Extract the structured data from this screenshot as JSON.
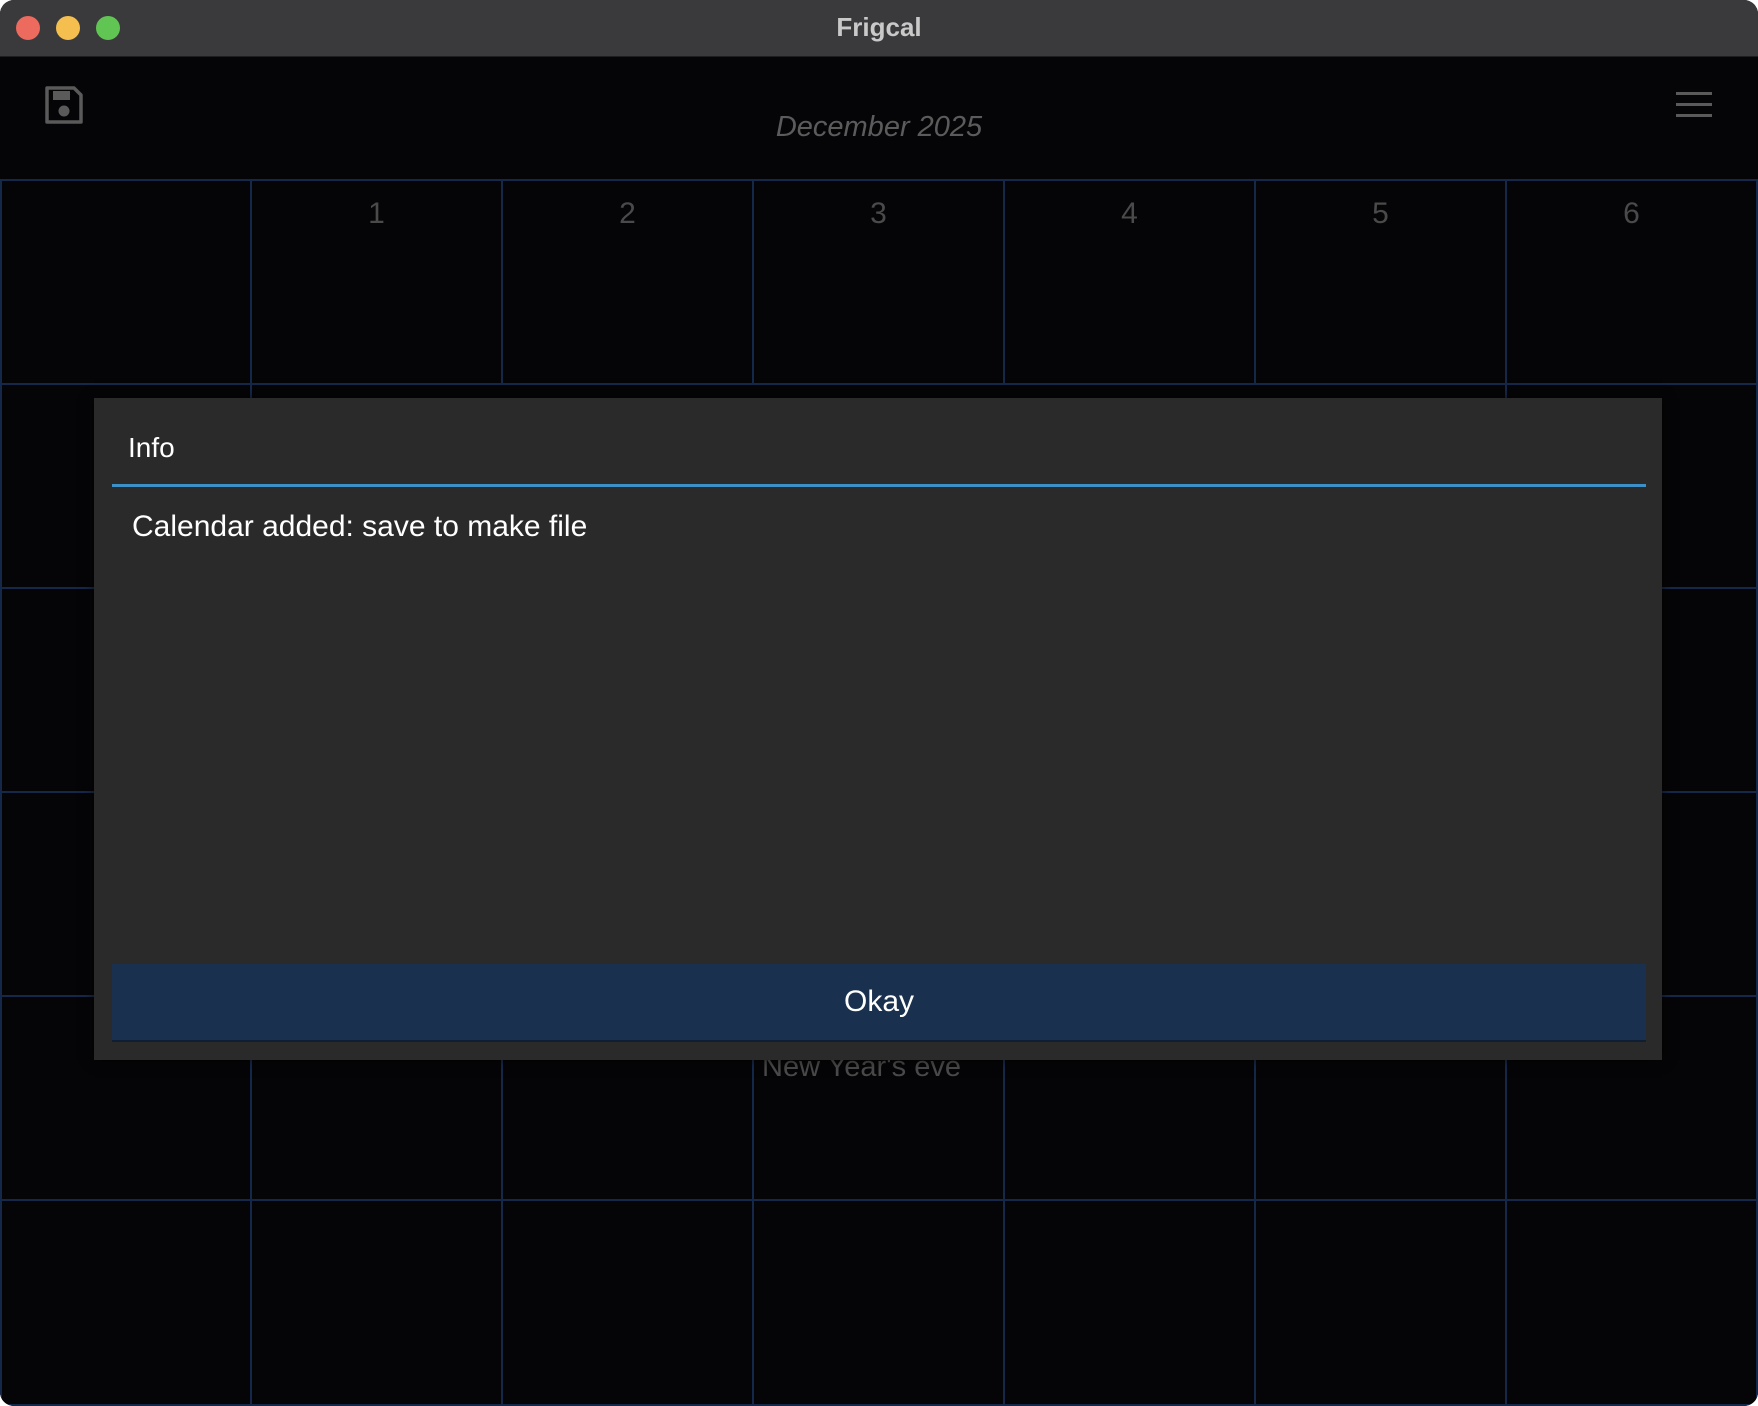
{
  "window": {
    "title": "Frigcal"
  },
  "toolbar": {
    "save_icon": "save-icon",
    "menu_icon": "hamburger-menu-icon",
    "month_title": "December 2025"
  },
  "calendar": {
    "first_row_days": [
      "",
      "1",
      "2",
      "3",
      "4",
      "5",
      "6"
    ],
    "visible_event": "New Year's eve"
  },
  "dialog": {
    "title": "Info",
    "message": "Calendar added: save to make file",
    "okay_label": "Okay"
  },
  "colors": {
    "grid_line": "#16284a",
    "dialog_bg": "#2a2a2a",
    "accent_line": "#3d8fc7",
    "button_bg": "#19314f"
  }
}
